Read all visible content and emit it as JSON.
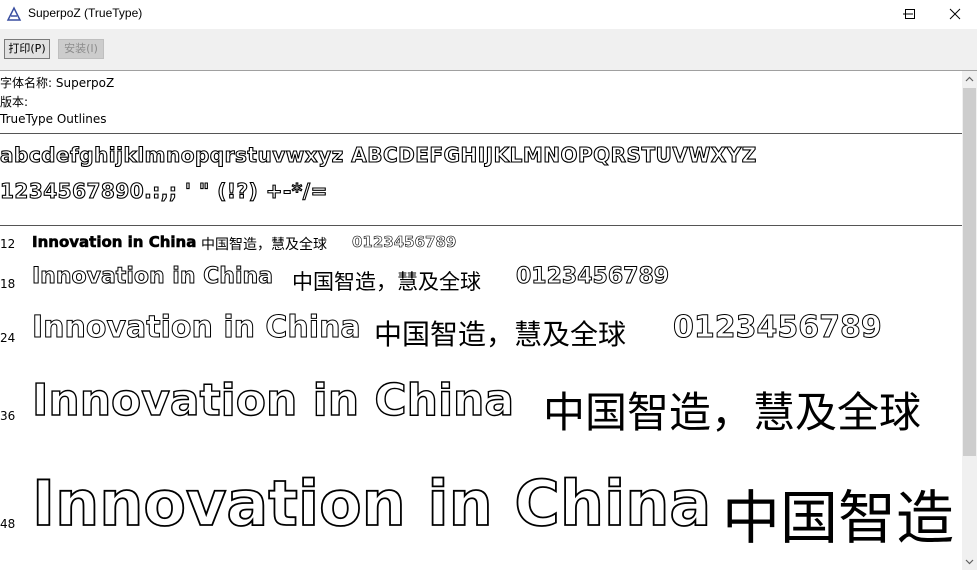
{
  "window": {
    "title": "SuperpoZ (TrueType)",
    "icon": "font-app-icon",
    "controls": {
      "minimize": "minimize-icon",
      "maximize": "maximize-icon",
      "close": "close-icon"
    }
  },
  "toolbar": {
    "print_label": "打印(P)",
    "install_label": "安装(I)"
  },
  "info": {
    "font_name": "字体名称: SuperpoZ",
    "version": "版本:",
    "outline_type": "TrueType Outlines"
  },
  "charset": {
    "lowercase_uppercase": "abcdefghijklmnopqrstuvwxyz ABCDEFGHIJKLMNOPQRSTUVWXYZ",
    "digits_symbols": "1234567890.:,; ' \" (!?) +-*/="
  },
  "samples": [
    {
      "size": "12",
      "latin": "Innovation in China",
      "cjk": "中国智造，慧及全球",
      "digits": "0123456789"
    },
    {
      "size": "18",
      "latin": "Innovation in China",
      "cjk": "中国智造，慧及全球",
      "digits": "0123456789"
    },
    {
      "size": "24",
      "latin": "Innovation in China",
      "cjk": "中国智造，慧及全球",
      "digits": "0123456789"
    },
    {
      "size": "36",
      "latin": "Innovation in China",
      "cjk": "中国智造，慧及全球",
      "digits": ""
    },
    {
      "size": "48",
      "latin": "Innovation in China",
      "cjk": "中国智造",
      "digits": ""
    }
  ],
  "colors": {
    "toolbar_bg": "#f0f0f0",
    "separator": "#555555",
    "scroll_thumb": "#cdcdcd"
  }
}
